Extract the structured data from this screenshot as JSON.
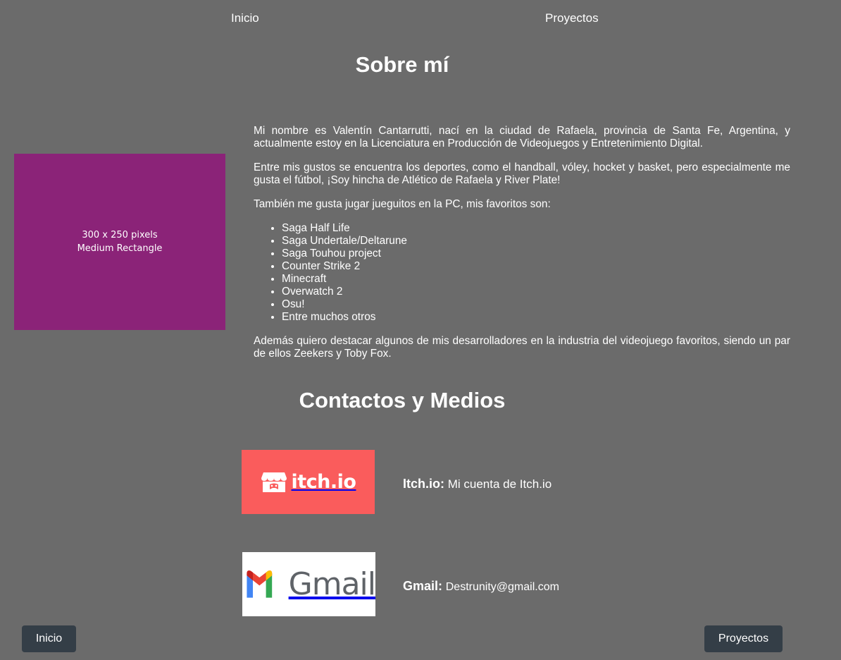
{
  "nav": {
    "inicio": "Inicio",
    "proyectos": "Proyectos"
  },
  "about": {
    "title": "Sobre mí",
    "paragraphs": [
      "Mi nombre es Valentín Cantarrutti, nací en la ciudad de Rafaela, provincia de Santa Fe, Argentina, y actualmente estoy en la Licenciatura en Producción de Videojuegos y Entretenimiento Digital.",
      "Entre mis gustos se encuentra los deportes, como el handball, vóley, hocket y basket, pero especialmente me gusta el fútbol, ¡Soy hincha de Atlético de Rafaela y River Plate!",
      "También me gusta jugar jueguitos en la PC, mis favoritos son:"
    ],
    "games": [
      "Saga Half Life",
      "Saga Undertale/Deltarune",
      "Saga Touhou project",
      "Counter Strike 2",
      "Minecraft",
      "Overwatch 2",
      "Osu!",
      "Entre muchos otros"
    ],
    "closing": "Además quiero destacar algunos de mis desarrolladores en la industria del videojuego favoritos, siendo un par de ellos Zeekers y Toby Fox."
  },
  "ad": {
    "line1": "300 x 250 pixels",
    "line2": "Medium Rectangle",
    "color": "#8b2378"
  },
  "contact": {
    "title": "Contactos y Medios",
    "itch": {
      "logo_text": "itch.io",
      "label": "Itch.io:",
      "value": "Mi cuenta de Itch.io",
      "color": "#fa5c5c"
    },
    "gmail": {
      "logo_text": "Gmail",
      "label": "Gmail:",
      "value": "Destrunity@gmail.com"
    }
  },
  "footer": {
    "inicio": "Inicio",
    "proyectos": "Proyectos",
    "button_color": "#343e47"
  },
  "colors": {
    "background": "#6b6b6b",
    "text": "#ffffff"
  }
}
